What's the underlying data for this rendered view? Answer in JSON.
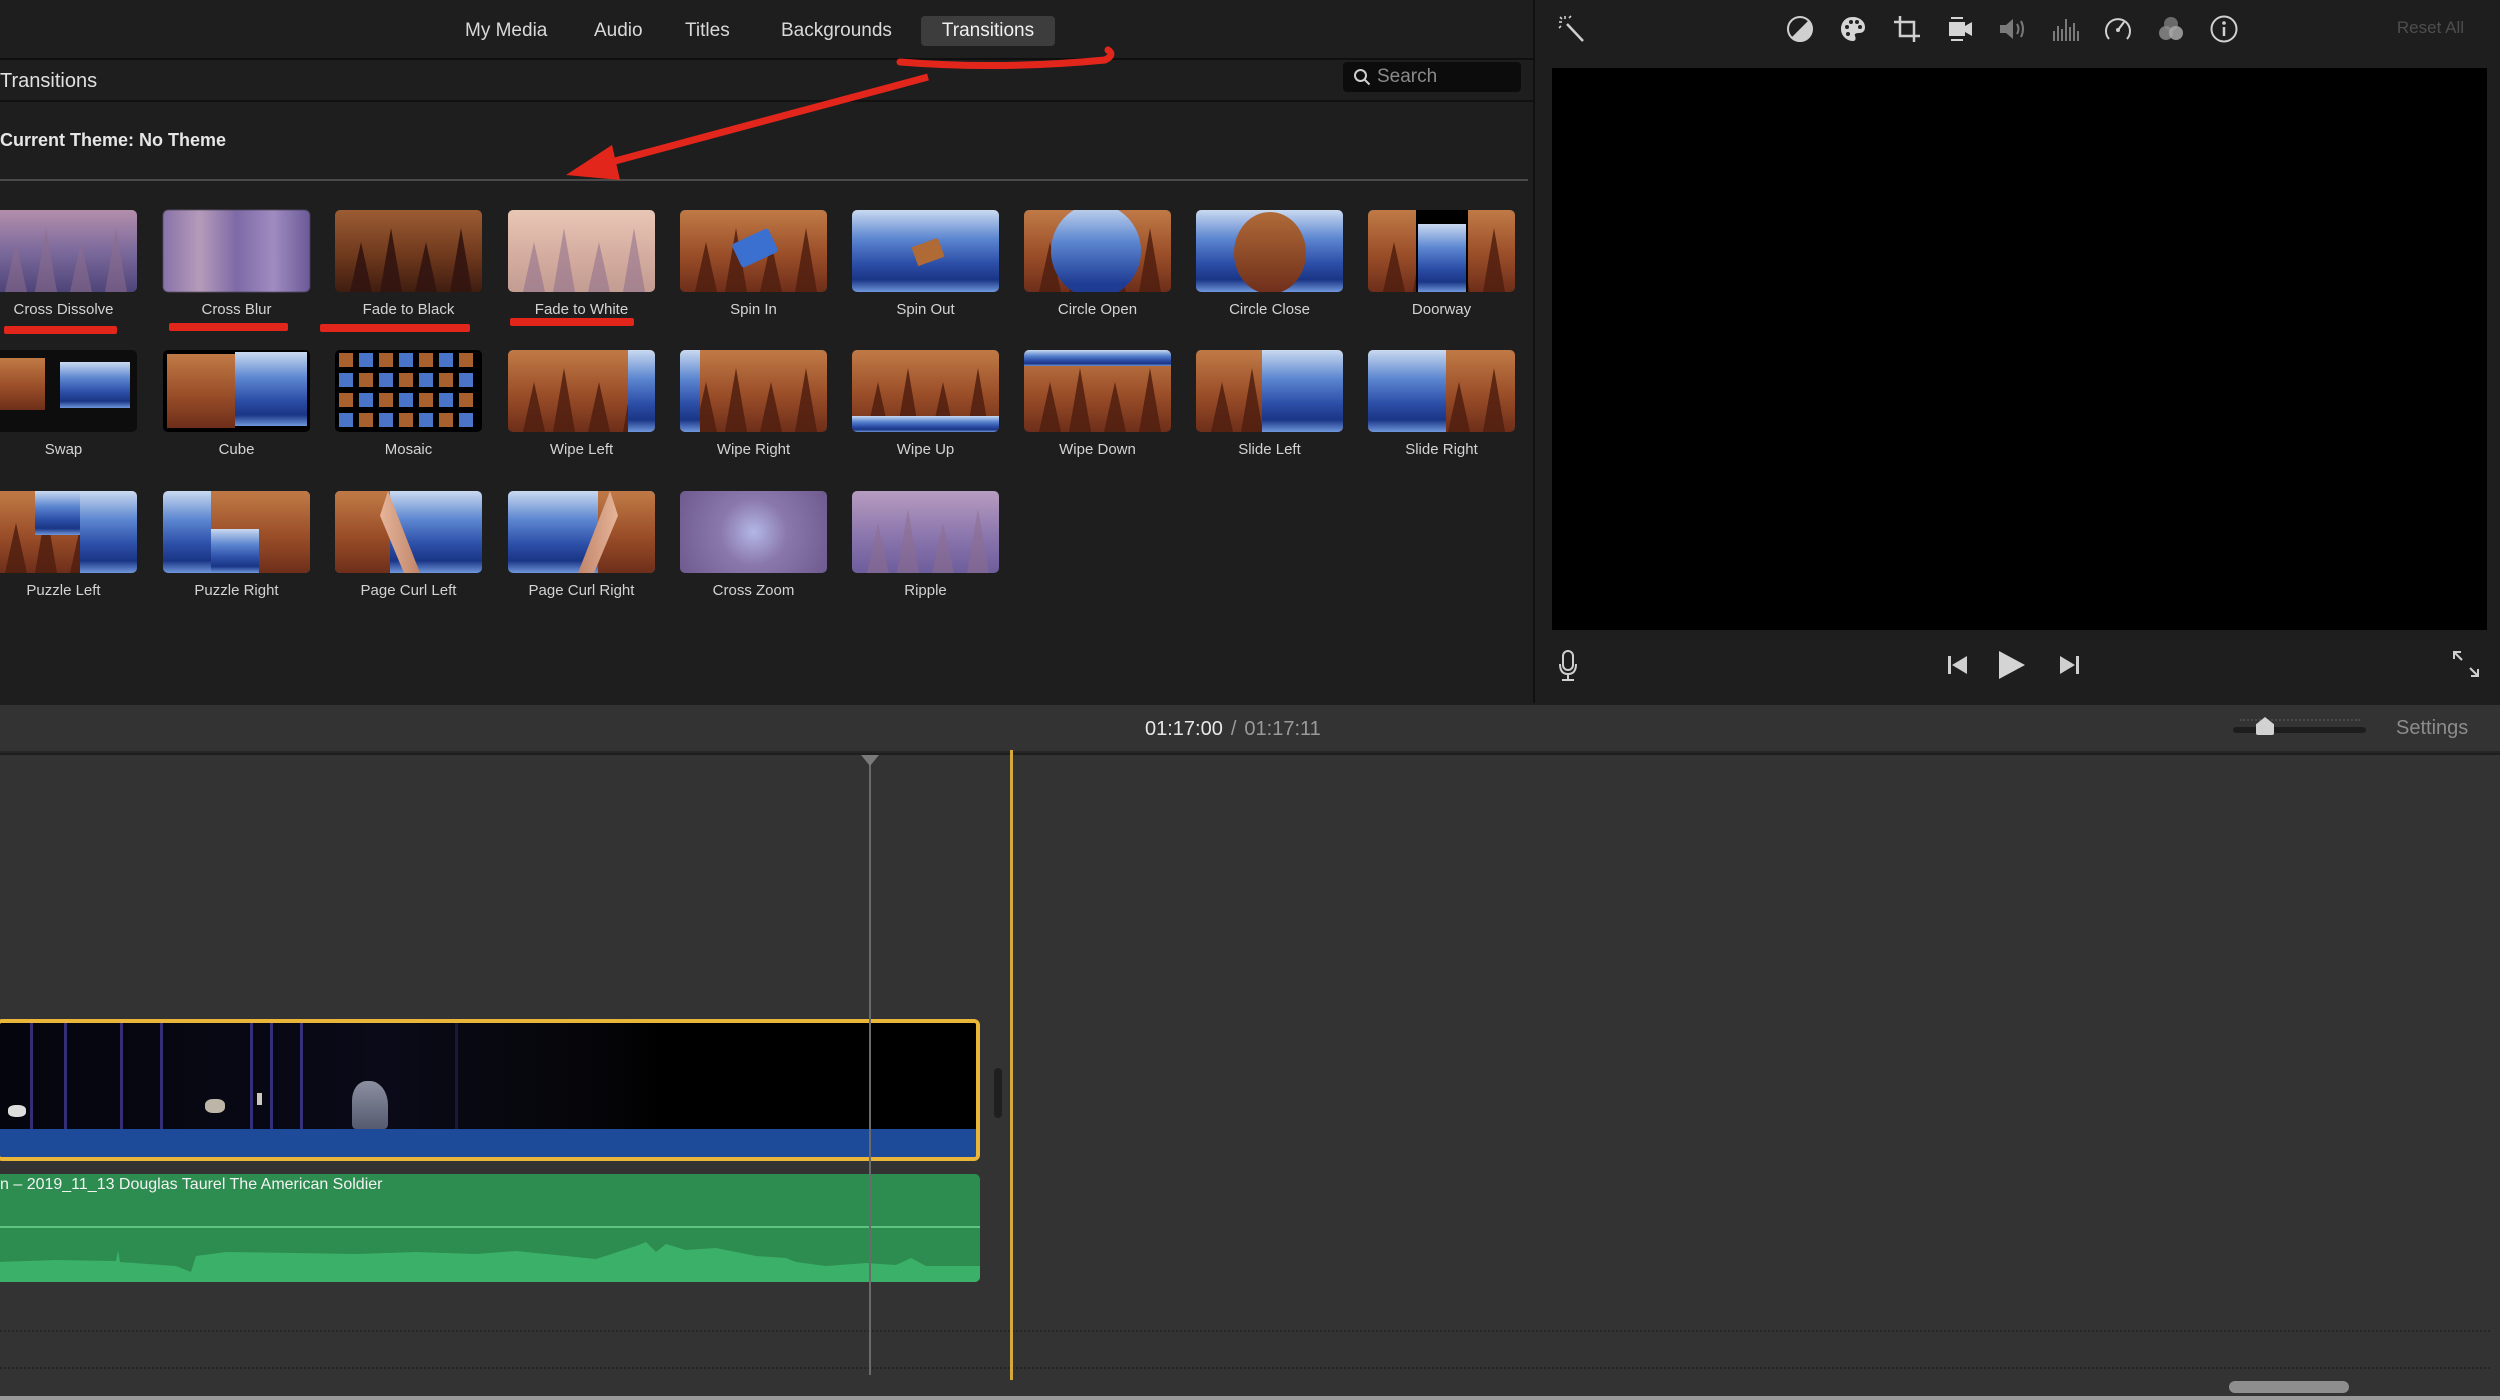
{
  "browser": {
    "tabs": [
      {
        "label": "My Media",
        "active": false
      },
      {
        "label": "Audio",
        "active": false
      },
      {
        "label": "Titles",
        "active": false
      },
      {
        "label": "Backgrounds",
        "active": false
      },
      {
        "label": "Transitions",
        "active": true
      }
    ],
    "section_title": "Transitions",
    "search_placeholder": "Search",
    "current_theme": "Current Theme: No Theme",
    "transitions": [
      {
        "label": "Cross Dissolve",
        "thumb": "dissolve",
        "annotated": true
      },
      {
        "label": "Cross Blur",
        "thumb": "blur",
        "annotated": true
      },
      {
        "label": "Fade to Black",
        "thumb": "black",
        "annotated": true
      },
      {
        "label": "Fade to White",
        "thumb": "white",
        "annotated": true
      },
      {
        "label": "Spin In",
        "thumb": "spin-in",
        "annotated": false
      },
      {
        "label": "Spin Out",
        "thumb": "spin-out",
        "annotated": false
      },
      {
        "label": "Circle Open",
        "thumb": "circle-open",
        "annotated": false
      },
      {
        "label": "Circle Close",
        "thumb": "circle-close",
        "annotated": false
      },
      {
        "label": "Doorway",
        "thumb": "doorway",
        "annotated": false
      },
      {
        "label": "Swap",
        "thumb": "swap",
        "annotated": false
      },
      {
        "label": "Cube",
        "thumb": "cube",
        "annotated": false
      },
      {
        "label": "Mosaic",
        "thumb": "mosaic",
        "annotated": false
      },
      {
        "label": "Wipe Left",
        "thumb": "wipe-left",
        "annotated": false
      },
      {
        "label": "Wipe Right",
        "thumb": "wipe-right",
        "annotated": false
      },
      {
        "label": "Wipe Up",
        "thumb": "wipe-up",
        "annotated": false
      },
      {
        "label": "Wipe Down",
        "thumb": "wipe-down",
        "annotated": false
      },
      {
        "label": "Slide Left",
        "thumb": "slide-left",
        "annotated": false
      },
      {
        "label": "Slide Right",
        "thumb": "slide-right",
        "annotated": false
      },
      {
        "label": "Puzzle Left",
        "thumb": "puzzle-left",
        "annotated": false
      },
      {
        "label": "Puzzle Right",
        "thumb": "puzzle-right",
        "annotated": false
      },
      {
        "label": "Page Curl Left",
        "thumb": "curl-left",
        "annotated": false
      },
      {
        "label": "Page Curl Right",
        "thumb": "curl-right",
        "annotated": false
      },
      {
        "label": "Cross Zoom",
        "thumb": "zoom",
        "annotated": false
      },
      {
        "label": "Ripple",
        "thumb": "ripple",
        "annotated": false
      }
    ]
  },
  "viewer": {
    "toolbar_icons": [
      "magic-wand-icon",
      "color-balance-icon",
      "color-correction-palette-icon",
      "crop-icon",
      "stabilization-camera-icon",
      "volume-icon",
      "equalizer-icon",
      "speed-gauge-icon",
      "clip-filter-icon",
      "info-icon"
    ],
    "reset_all_label": "Reset All",
    "controls": [
      "microphone-icon",
      "skip-back-icon",
      "play-icon",
      "skip-forward-icon",
      "fullscreen-icon"
    ]
  },
  "timeline": {
    "current_time": "01:17:00",
    "separator": "/",
    "total_time": "01:17:11",
    "zoom_level": 0.2,
    "settings_label": "Settings",
    "audio_clip_title": "n – 2019_11_13 Douglas Taurel The American Soldier"
  },
  "annotations": {
    "color": "#e3261b",
    "arrow_points_to": "transitions grid",
    "underlined_items": [
      "Cross Dissolve",
      "Cross Blur",
      "Fade to Black",
      "Fade to White"
    ],
    "underlined_tab": "Transitions"
  },
  "colors": {
    "accent_selection": "#eab63a",
    "video_clip_bar": "#1d4a99",
    "audio_clip": "#2d8c50",
    "annotation_red": "#e3261b"
  }
}
